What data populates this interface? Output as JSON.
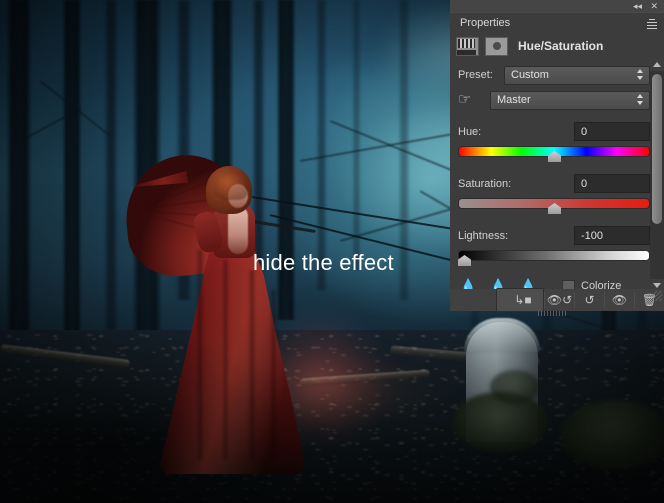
{
  "panel": {
    "tab_label": "Properties",
    "adjustment_title": "Hue/Saturation",
    "titlebar": {
      "collapse_label": "◂◂",
      "close_label": "✕"
    },
    "preset": {
      "label": "Preset:",
      "value": "Custom"
    },
    "channel": {
      "value": "Master"
    },
    "hue": {
      "label": "Hue:",
      "value": "0",
      "slider_percent": 50
    },
    "saturation": {
      "label": "Saturation:",
      "value": "0",
      "slider_percent": 50
    },
    "lightness": {
      "label": "Lightness:",
      "value": "-100",
      "slider_percent": 0
    },
    "colorize": {
      "label": "Colorize",
      "checked": false
    },
    "footer": {
      "clip_to_layer": "clip-to-layer",
      "toggle_previous": "toggle-previous-state",
      "reset": "reset",
      "toggle_visibility": "toggle-layer-visibility",
      "delete": "delete-adjustment-layer"
    },
    "colors": {
      "panel_bg": "#3c3c3c",
      "panel_dark": "#2f2f2f",
      "field_bg": "#2c2c2c",
      "text": "#d4d4d4"
    }
  },
  "canvas": {
    "caption": "hide the effect"
  }
}
